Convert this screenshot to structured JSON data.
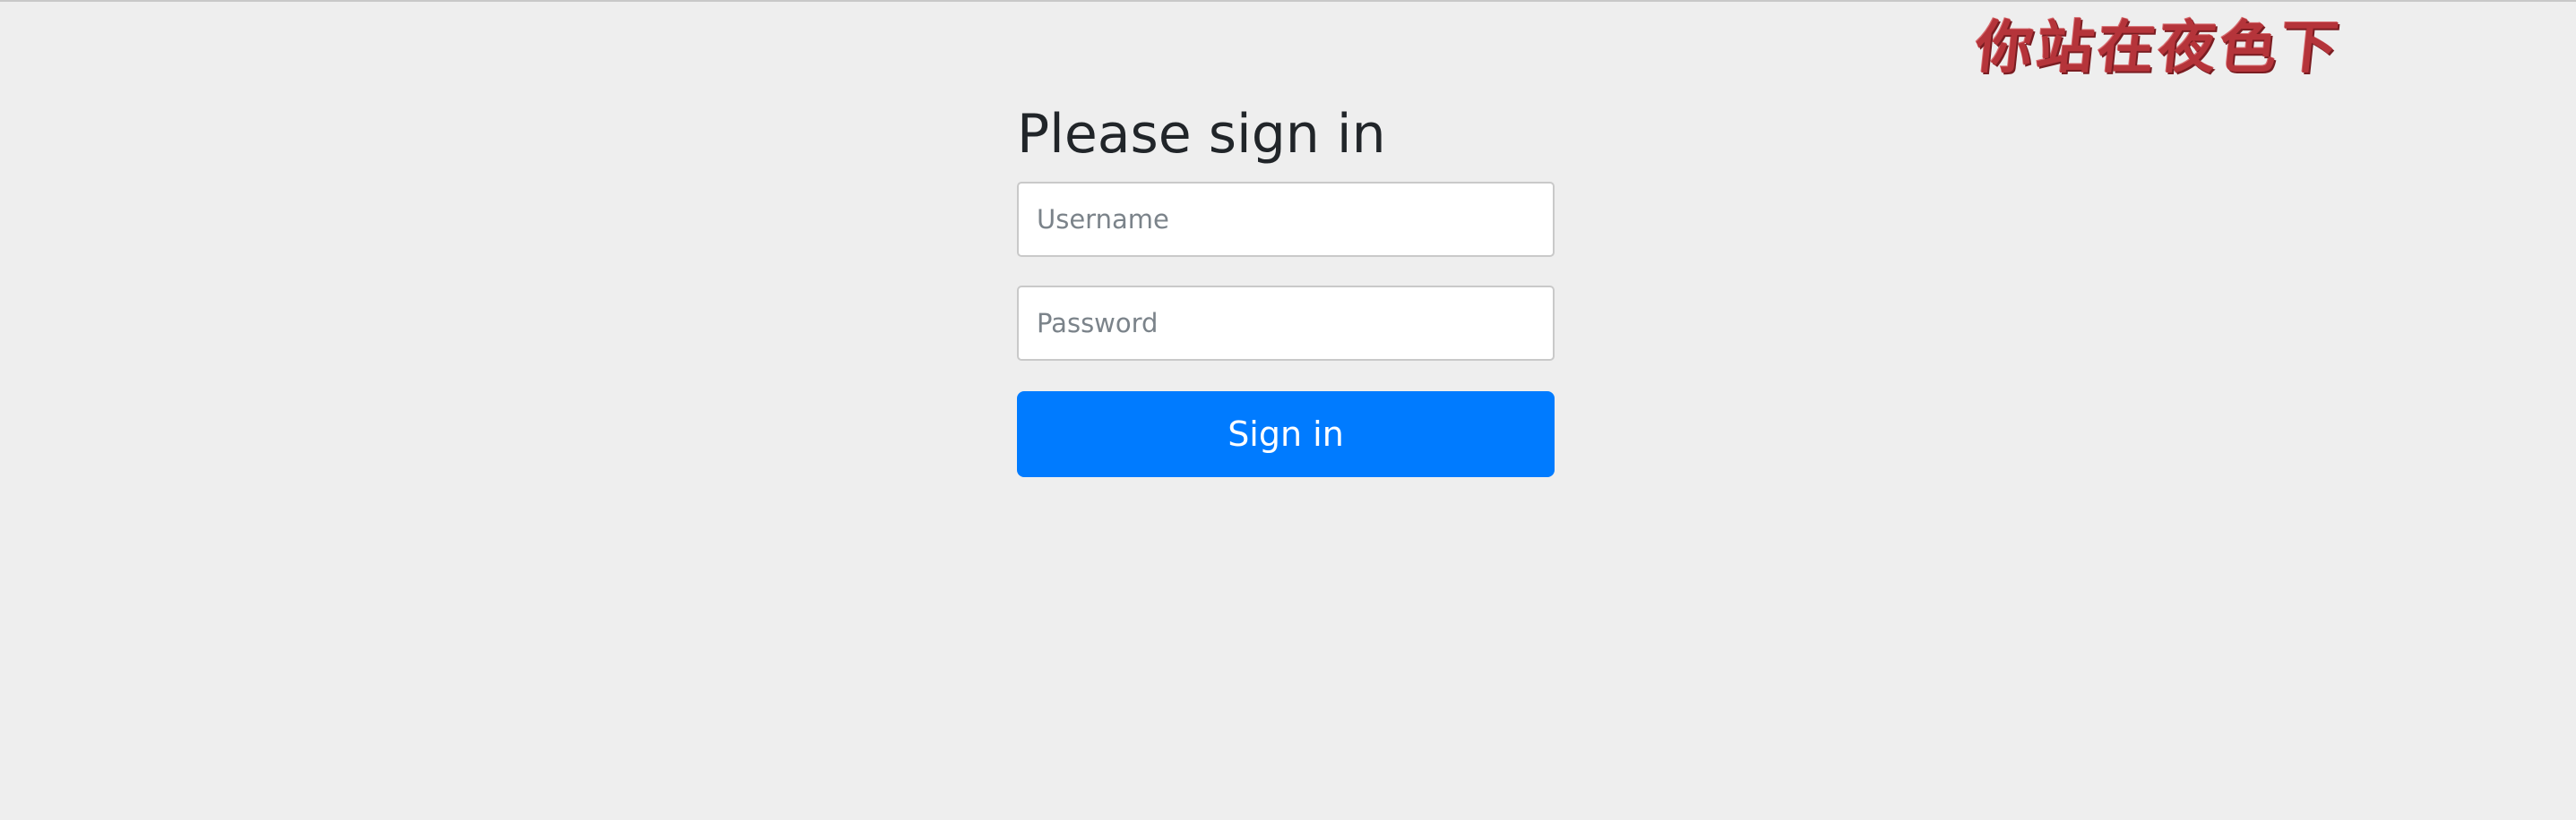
{
  "header": {
    "watermark_text": "你站在夜色下"
  },
  "form": {
    "heading": "Please sign in",
    "username": {
      "placeholder": "Username",
      "value": ""
    },
    "password": {
      "placeholder": "Password",
      "value": ""
    },
    "submit_label": "Sign in"
  },
  "colors": {
    "page_background": "#eeeeee",
    "primary_button": "#007bff",
    "watermark": "#b5343a",
    "heading_text": "#212529"
  }
}
